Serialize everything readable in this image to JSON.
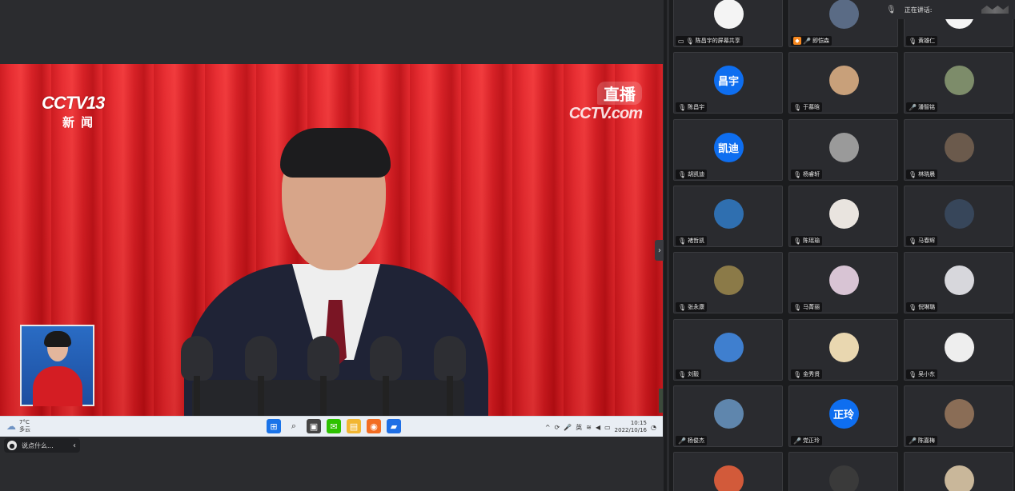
{
  "shared_screen": {
    "channel_logo": "CCTV13",
    "channel_sub": "新闻",
    "live_label": "直播",
    "live_domain": "CCTV.com",
    "taskbar": {
      "weather_temp": "7°C",
      "weather_desc": "多云",
      "lang": "英",
      "time": "10:15",
      "date": "2022/10/16"
    },
    "chat_placeholder": "说点什么..."
  },
  "speaking_indicator": {
    "label": "正在讲话:"
  },
  "participants": [
    {
      "name": "陈昌宇的屏幕共享",
      "avatar_type": "image",
      "avatar_desc": "text-answers",
      "muted": true,
      "screen_share": true
    },
    {
      "name": "即恺森",
      "avatar_type": "image",
      "avatar_desc": "cartoon-girl",
      "muted": false,
      "host": true
    },
    {
      "name": "黄雄仁",
      "avatar_type": "image",
      "avatar_desc": "white",
      "muted": true
    },
    {
      "name": "陈昌宇",
      "avatar_type": "text",
      "avatar_text": "昌宇",
      "muted": true
    },
    {
      "name": "于慕晗",
      "avatar_type": "image",
      "avatar_desc": "dog",
      "muted": true
    },
    {
      "name": "潘智铭",
      "avatar_type": "image",
      "avatar_desc": "people-outdoor",
      "muted": false
    },
    {
      "name": "胡凯迪",
      "avatar_type": "text",
      "avatar_text": "凯迪",
      "muted": true
    },
    {
      "name": "杨睿轩",
      "avatar_type": "image",
      "avatar_desc": "smiley",
      "muted": true
    },
    {
      "name": "林晓晨",
      "avatar_type": "image",
      "avatar_desc": "person-indoor",
      "muted": true
    },
    {
      "name": "褚哲凯",
      "avatar_type": "image",
      "avatar_desc": "blue-dragon",
      "muted": true
    },
    {
      "name": "陈瑶瑜",
      "avatar_type": "image",
      "avatar_desc": "anime-girl",
      "muted": true
    },
    {
      "name": "马春辉",
      "avatar_type": "image",
      "avatar_desc": "person-night",
      "muted": true
    },
    {
      "name": "张永康",
      "avatar_type": "image",
      "avatar_desc": "figurine",
      "muted": true
    },
    {
      "name": "马菁丽",
      "avatar_type": "image",
      "avatar_desc": "girl-portrait",
      "muted": true
    },
    {
      "name": "倪琳璐",
      "avatar_type": "image",
      "avatar_desc": "anime-white-hair",
      "muted": true
    },
    {
      "name": "刘毅",
      "avatar_type": "image",
      "avatar_desc": "blue-planet",
      "muted": true
    },
    {
      "name": "金秀贤",
      "avatar_type": "image",
      "avatar_desc": "pastel-art",
      "muted": true
    },
    {
      "name": "吴小东",
      "avatar_type": "image",
      "avatar_desc": "white-cat",
      "muted": true
    },
    {
      "name": "杨俊杰",
      "avatar_type": "image",
      "avatar_desc": "mountain-lake",
      "muted": false
    },
    {
      "name": "党正玲",
      "avatar_type": "text",
      "avatar_text": "正玲",
      "muted": false
    },
    {
      "name": "陈嘉梅",
      "avatar_type": "image",
      "avatar_desc": "brown-pet",
      "muted": false
    },
    {
      "name": "",
      "avatar_type": "image",
      "avatar_desc": "cartoon-red",
      "muted": false
    },
    {
      "name": "",
      "avatar_type": "image",
      "avatar_desc": "dark-car",
      "muted": false
    },
    {
      "name": "",
      "avatar_type": "image",
      "avatar_desc": "soldier-toy",
      "muted": false
    }
  ],
  "colors": {
    "accent_blue": "#0e6ef0",
    "host_orange": "#f7881f",
    "curtain_red": "#e52a2f"
  }
}
